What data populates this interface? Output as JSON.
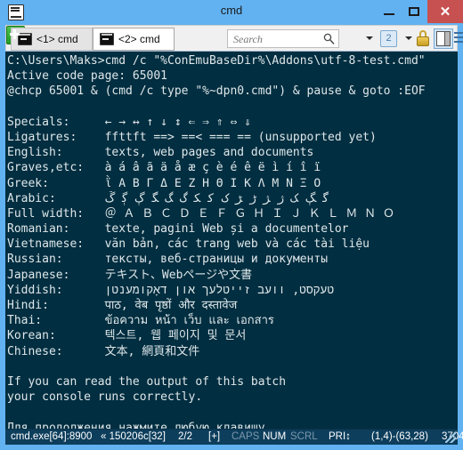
{
  "window": {
    "title": "cmd",
    "app_icon": "console-window-icon",
    "minimize_label": "–",
    "maximize_label": "□",
    "close_label": "✕",
    "close_color": "#c75050",
    "chrome_color": "#62b2f2"
  },
  "tabs": [
    {
      "label": "<1> cmd",
      "icon": "console-tab-icon",
      "active": false
    },
    {
      "label": "<2> cmd",
      "icon": "console-tab-icon",
      "active": true
    }
  ],
  "toolbar": {
    "search": {
      "placeholder": "Search",
      "value": "",
      "icon": "search-icon"
    },
    "new_console": {
      "icon": "green-plus-icon",
      "label": ""
    },
    "new_console_caret": {
      "icon": "chevron-down-icon"
    },
    "active_count": {
      "label": "2",
      "icon": "console-count-icon"
    },
    "active_count_caret": {
      "icon": "chevron-down-icon"
    },
    "lock": {
      "icon": "padlock-icon"
    },
    "split": {
      "icon": "split-pane-icon"
    },
    "menu": {
      "icon": "hamburger-menu-icon"
    }
  },
  "console": {
    "background": "#012E40",
    "foreground": "#dfe7ea",
    "lines": [
      "C:\\Users\\Maks>cmd /c \"%ConEmuBaseDir%\\Addons\\utf-8-test.cmd\"",
      "Active code page: 65001",
      "@chcp 65001 & (cmd /c type \"%~dpn0.cmd\") & pause & goto :EOF",
      "",
      "Specials:     ← → ↔ ↑ ↓ ↕ ⇐ ⇒ ⇑ ⇔ ⇓",
      "Ligatures:    ffttft ==> ==< === == (unsupported yet)",
      "English:      texts, web pages and documents",
      "Graves,etc:   à á â ã ä å æ ç è é ê ë ì í î ï",
      "Greek:        ῒ Α Β Γ Δ Ε Ζ Η Θ Ι Κ Λ Μ Ν Ξ Ο",
      "Arabic:       ﮔ ﮗ ﮏ ﮊ ﮋ ﮌ ﮍ ﮎ ﮐ ﮑ ﮒ ﮓ ﮕ ﮖ ﮘ ﮚ",
      "Full width:   ＠ Ａ Ｂ Ｃ Ｄ Ｅ Ｆ Ｇ Ｈ Ｉ Ｊ Ｋ Ｌ Ｍ Ｎ Ｏ",
      "Romanian:     texte, pagini Web și a documentelor",
      "Vietnamese:   văn bản, các trang web và các tài liệu",
      "Russian:      тексты, веб-страницы и документы",
      "Japanese:     テキスト、Webページや文書",
      "Yiddish:      טעקסט, וועב זייטלעך און דאָקומענטן",
      "Hindi:        पाठ, वेब पृष्ठों और दस्तावेज",
      "Thai:         ข้อความ หน้า เว็บ และ เอกสาร",
      "Korean:       텍스트, 웹 페이지 및 문서",
      "Chinese:      文本, 網頁和文件",
      "",
      "If you can read the output of this batch",
      "your console runs correctly.",
      "",
      "Для продолжения нажмите любую клавишу . . ."
    ]
  },
  "statusbar": {
    "process": "cmd.exe[64]:8900",
    "build": "« 150206c[32]",
    "tab_counter": "2/2",
    "selection": "[+]",
    "caps": "CAPS",
    "num": "NUM",
    "scrl": "SCRL",
    "priority": "PRI↕",
    "coords": "(1,4)-(63,28)",
    "scroll_count": "3704",
    "resize_grip": "resize-grip-icon"
  }
}
